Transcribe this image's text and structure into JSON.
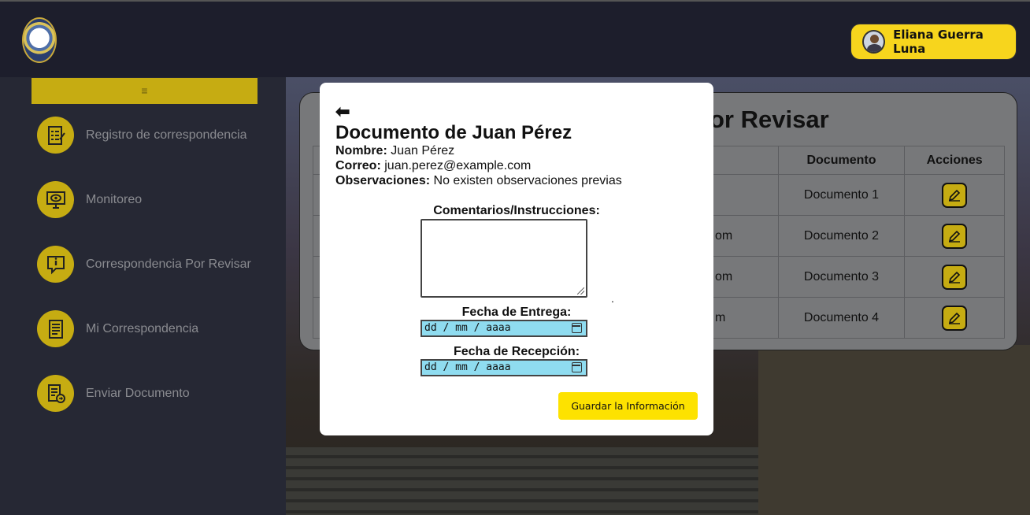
{
  "header": {
    "logo_icon": "university-seal-logo",
    "user_name": "Eliana Guerra Luna",
    "user_avatar_icon": "user-avatar-icon"
  },
  "sidebar": {
    "toggle_label": "≡",
    "items": [
      {
        "label": "Registro de correspondencia",
        "icon": "checklist-icon"
      },
      {
        "label": "Monitoreo",
        "icon": "monitor-eye-icon"
      },
      {
        "label": "Correspondencia Por Revisar",
        "icon": "info-chat-icon"
      },
      {
        "label": "Mi Correspondencia",
        "icon": "document-list-icon"
      },
      {
        "label": "Enviar Documento",
        "icon": "send-document-icon"
      }
    ]
  },
  "main": {
    "title_visible": "or Revisar",
    "columns": [
      "Documento",
      "Acciones"
    ],
    "rows": [
      {
        "partial": "",
        "document": "Documento 1"
      },
      {
        "partial": "om",
        "document": "Documento 2"
      },
      {
        "partial": "om",
        "document": "Documento 3"
      },
      {
        "partial": "m",
        "document": "Documento 4"
      }
    ]
  },
  "modal": {
    "back_icon": "back-arrow-icon",
    "back_glyph": "⬅",
    "title": "Documento de Juan Pérez",
    "nombre_label": "Nombre:",
    "nombre_value": "Juan Pérez",
    "correo_label": "Correo:",
    "correo_value": "juan.perez@example.com",
    "observaciones_label": "Observaciones:",
    "observaciones_value": "No existen observaciones previas",
    "comments_label": "Comentarios/Instrucciones:",
    "comments_value": "",
    "dot": ".",
    "entrega_label": "Fecha de Entrega:",
    "entrega_placeholder": "dd / mm / aaaa",
    "recepcion_label": "Fecha de Recepción:",
    "recepcion_placeholder": "dd / mm / aaaa",
    "save_label": "Guardar la Información"
  },
  "colors": {
    "accent": "#fde200",
    "sidebar_icon_bg": "#c6ac12",
    "date_input_bg": "#8fdcf0"
  }
}
